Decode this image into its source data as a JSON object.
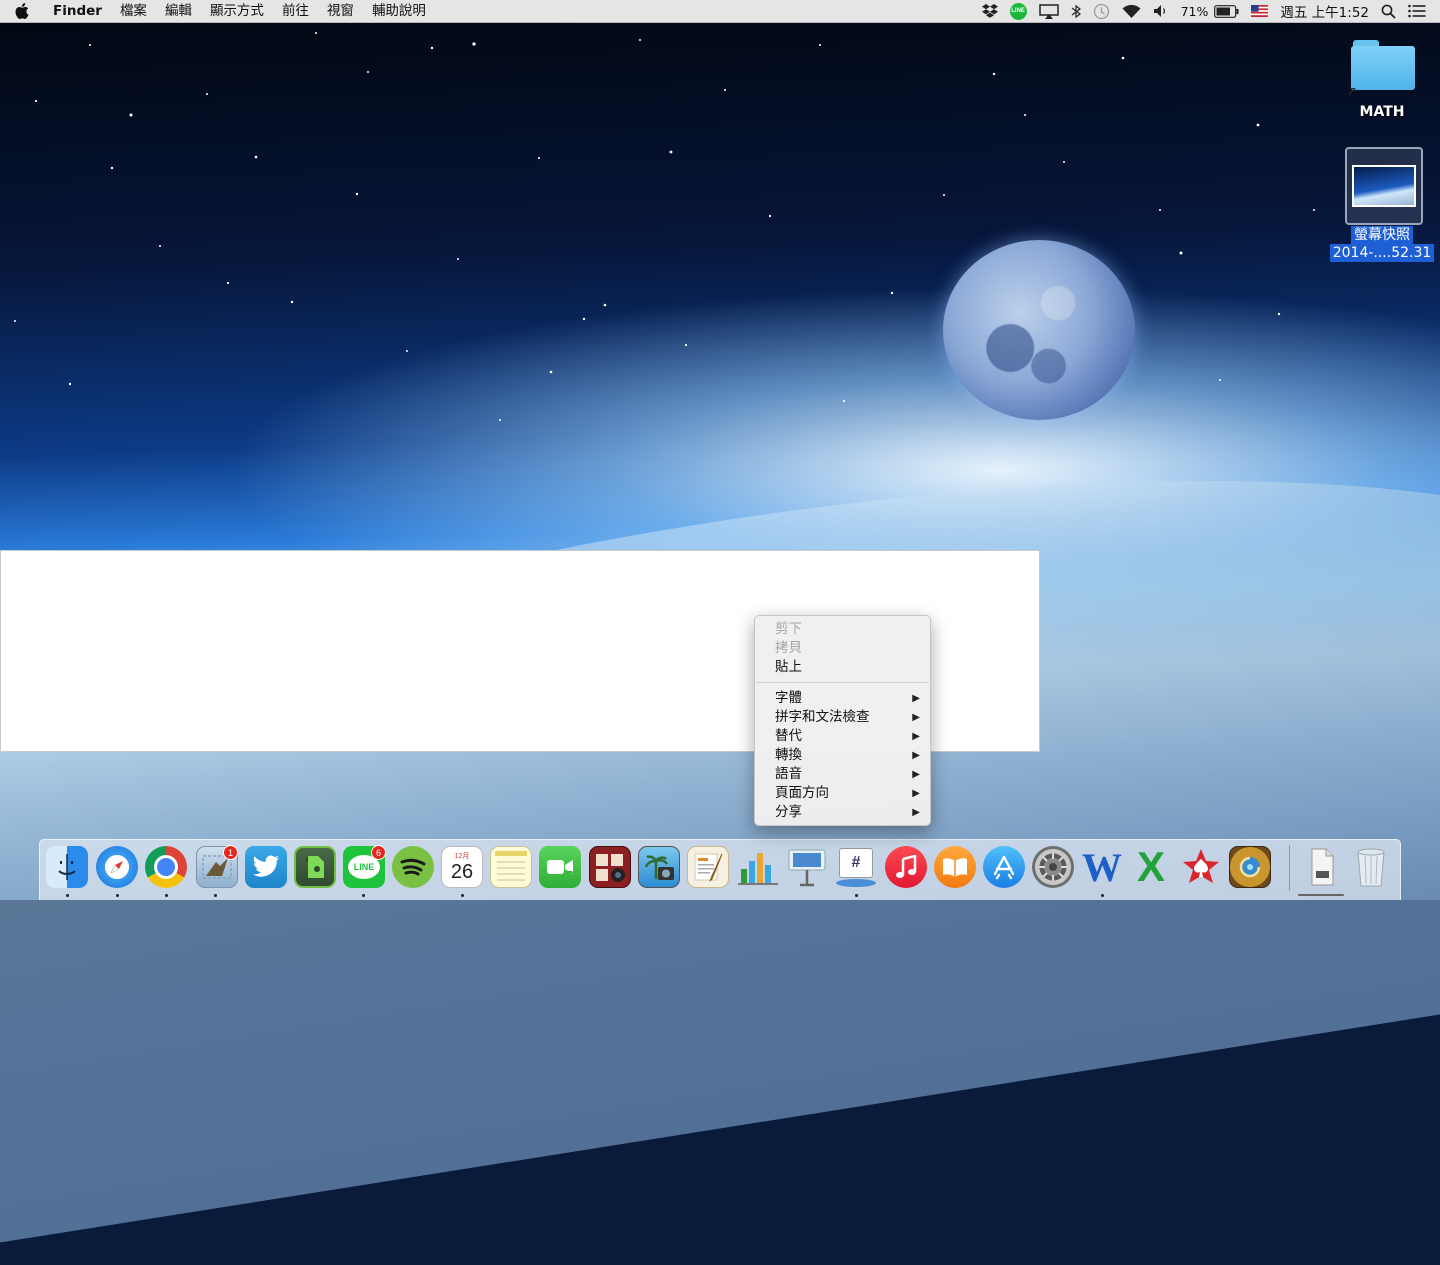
{
  "menubar": {
    "app_name": "Finder",
    "menus": [
      "檔案",
      "編輯",
      "顯示方式",
      "前往",
      "視窗",
      "輔助說明"
    ],
    "status": {
      "line_icon_label": "LINE",
      "battery_percent": "71%",
      "datetime": "週五 上午1:52"
    }
  },
  "desktop": {
    "folder_label": "MATH",
    "screenshot_label_line1": "螢幕快照",
    "screenshot_label_line2": "2014-....52.31"
  },
  "context_menu": {
    "items": [
      {
        "label": "剪下",
        "enabled": false
      },
      {
        "label": "拷貝",
        "enabled": false
      },
      {
        "label": "貼上",
        "enabled": true
      }
    ],
    "submenus": [
      {
        "label": "字體"
      },
      {
        "label": "拼字和文法檢查"
      },
      {
        "label": "替代"
      },
      {
        "label": "轉換"
      },
      {
        "label": "語音"
      },
      {
        "label": "頁面方向"
      },
      {
        "label": "分享"
      }
    ],
    "submenu_arrow": "▶"
  },
  "dock": {
    "mail_badge": "1",
    "line_badge": "6",
    "line_label": "LINE",
    "calendar_month": "12月",
    "calendar_day": "26",
    "word_letter": "W",
    "excel_letter": "X",
    "slack_symbol": "#"
  },
  "colors": {
    "selection_blue": "#1f5fd6",
    "badge_red": "#e3281e",
    "folder_blue": "#5ab9ec"
  }
}
